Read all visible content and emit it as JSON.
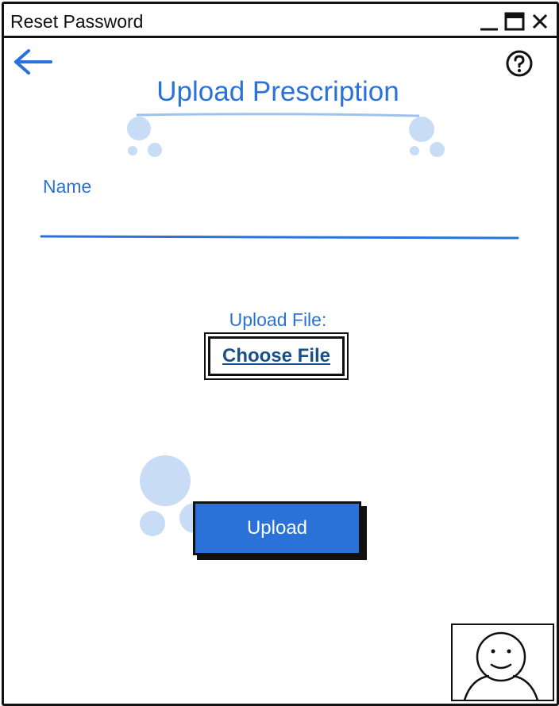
{
  "window": {
    "title": "Reset Password",
    "controls": [
      "minimize-icon",
      "maximize-icon",
      "close-icon"
    ]
  },
  "header": {
    "back_icon": "arrow-left-icon",
    "help_icon": "help-circle-icon",
    "heading": "Upload Prescription"
  },
  "form": {
    "name_label": "Name",
    "name_value": "",
    "upload_label": "Upload File:",
    "choose_file_label": "Choose File",
    "submit_label": "Upload"
  },
  "footer": {
    "avatar_icon": "user-avatar-icon"
  },
  "colors": {
    "accent": "#2a72d8",
    "bubble": "#c8dcf5",
    "link": "#1a4f8a"
  }
}
